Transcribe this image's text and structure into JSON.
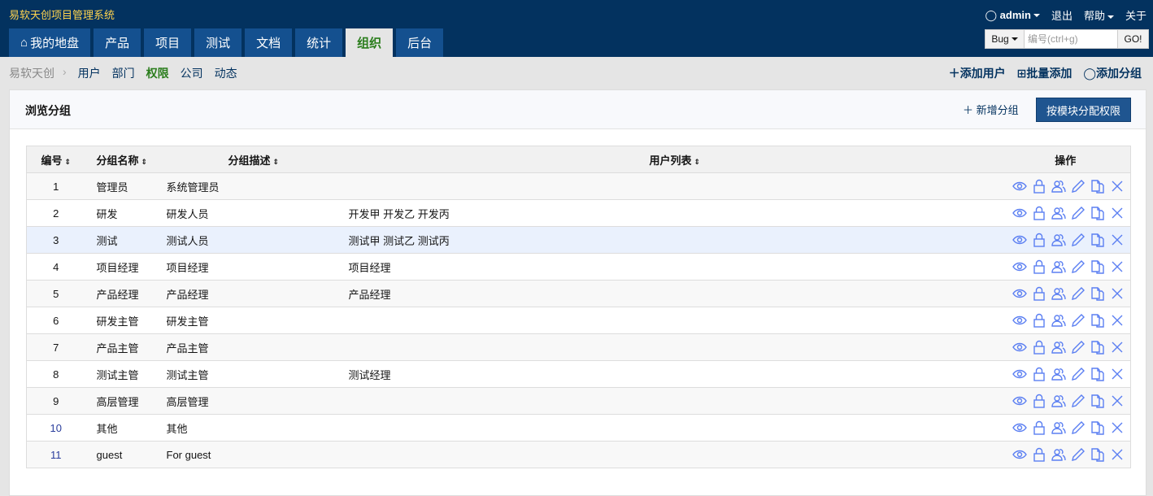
{
  "app": {
    "title": "易软天创项目管理系统"
  },
  "user": {
    "name": "admin",
    "logout": "退出",
    "help": "帮助",
    "about": "关于"
  },
  "nav": [
    "我的地盘",
    "产品",
    "项目",
    "测试",
    "文档",
    "统计",
    "组织",
    "后台"
  ],
  "nav_active": 6,
  "search": {
    "type": "Bug",
    "placeholder": "编号(ctrl+g)",
    "go": "GO!"
  },
  "subnav": {
    "crumb": "易软天创",
    "items": [
      "用户",
      "部门",
      "权限",
      "公司",
      "动态"
    ],
    "active": 2
  },
  "actions": {
    "add_user": "添加用户",
    "batch_add": "批量添加",
    "add_group": "添加分组"
  },
  "panel": {
    "title": "浏览分组",
    "new_group": "新增分组",
    "assign_button": "按模块分配权限"
  },
  "table": {
    "headers": [
      "编号",
      "分组名称",
      "分组描述",
      "用户列表",
      "操作"
    ],
    "rows": [
      [
        "1",
        "管理员",
        "系统管理员",
        ""
      ],
      [
        "2",
        "研发",
        "研发人员",
        "开发甲 开发乙 开发丙"
      ],
      [
        "3",
        "测试",
        "测试人员",
        "测试甲 测试乙 测试丙"
      ],
      [
        "4",
        "项目经理",
        "项目经理",
        "项目经理"
      ],
      [
        "5",
        "产品经理",
        "产品经理",
        "产品经理"
      ],
      [
        "6",
        "研发主管",
        "研发主管",
        ""
      ],
      [
        "7",
        "产品主管",
        "产品主管",
        ""
      ],
      [
        "8",
        "测试主管",
        "测试主管",
        "测试经理"
      ],
      [
        "9",
        "高层管理",
        "高层管理",
        ""
      ],
      [
        "10",
        "其他",
        "其他",
        ""
      ],
      [
        "11",
        "guest",
        "For guest",
        ""
      ]
    ]
  },
  "colors": {
    "header_bg": "#03325f",
    "tab_bg": "#14508f",
    "active_green": "#2a7d1c",
    "icon_blue": "#5b7ff2"
  }
}
